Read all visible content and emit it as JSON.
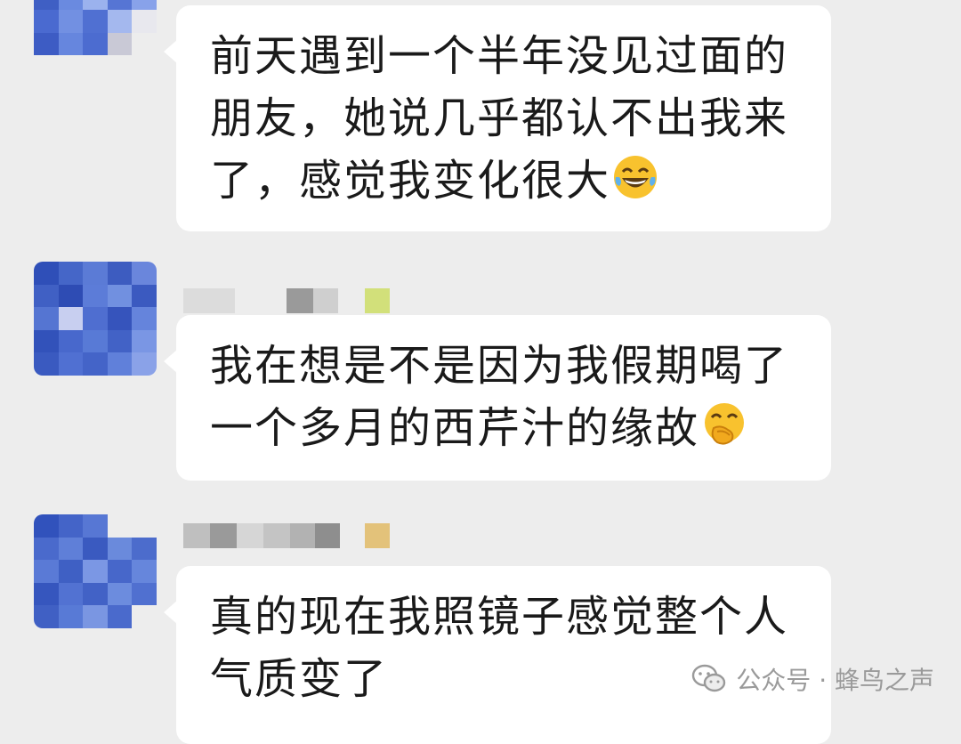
{
  "messages": [
    {
      "text": "前天遇到一个半年没见过面的朋友，她说几乎都认不出我来了，感觉我变化很大",
      "emoji": "laughing-tears-emoji"
    },
    {
      "text": "我在想是不是因为我假期喝了一个多月的西芹汁的缘故",
      "emoji": "hand-over-mouth-emoji"
    },
    {
      "text": "真的现在我照镜子感觉整个人气质变了",
      "emoji": ""
    }
  ],
  "watermark": {
    "label": "公众号 · 蜂鸟之声",
    "icon": "wechat-icon"
  },
  "colors": {
    "background": "#ededed",
    "bubble": "#ffffff",
    "text": "#1a1a1a",
    "watermark": "#9a9a9a"
  }
}
